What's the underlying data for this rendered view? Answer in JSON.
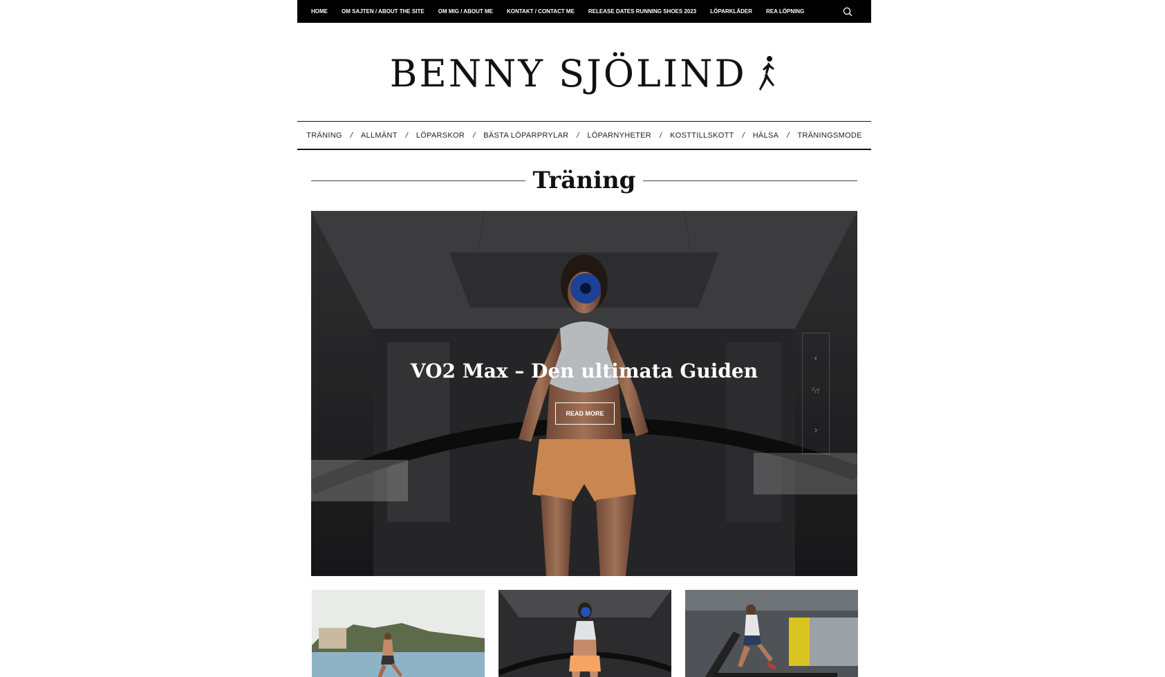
{
  "topnav": {
    "items": [
      "HOME",
      "OM SAJTEN / ABOUT THE SITE",
      "OM MIG / ABOUT ME",
      "KONTAKT / CONTACT ME",
      "RELEASE DATES RUNNING SHOES 2023",
      "LÖPARKLÄDER",
      "REA LÖPNING"
    ],
    "search_icon": "search-icon"
  },
  "site": {
    "logo_text": "BENNY SJÖLIND",
    "logo_icon": "runner-icon"
  },
  "catnav": {
    "items": [
      "TRÄNING",
      "ALLMÄNT",
      "LÖPARSKOR",
      "BÄSTA LÖPARPRYLAR",
      "LÖPARNYHETER",
      "KOSTTILLSKOTT",
      "HÄLSA",
      "TRÄNINGSMODE"
    ],
    "separator": "/"
  },
  "section": {
    "title": "Träning"
  },
  "hero": {
    "title": "VO2 Max – Den ultimata Guiden",
    "button_label": "READ MORE",
    "counter_current": "2",
    "counter_total": "7",
    "prev_icon": "chevron-left-icon",
    "next_icon": "chevron-right-icon"
  },
  "colors": {
    "topbar_bg": "#000000",
    "text": "#111111",
    "shorts": "#f6a463",
    "mask": "#2450b8"
  }
}
